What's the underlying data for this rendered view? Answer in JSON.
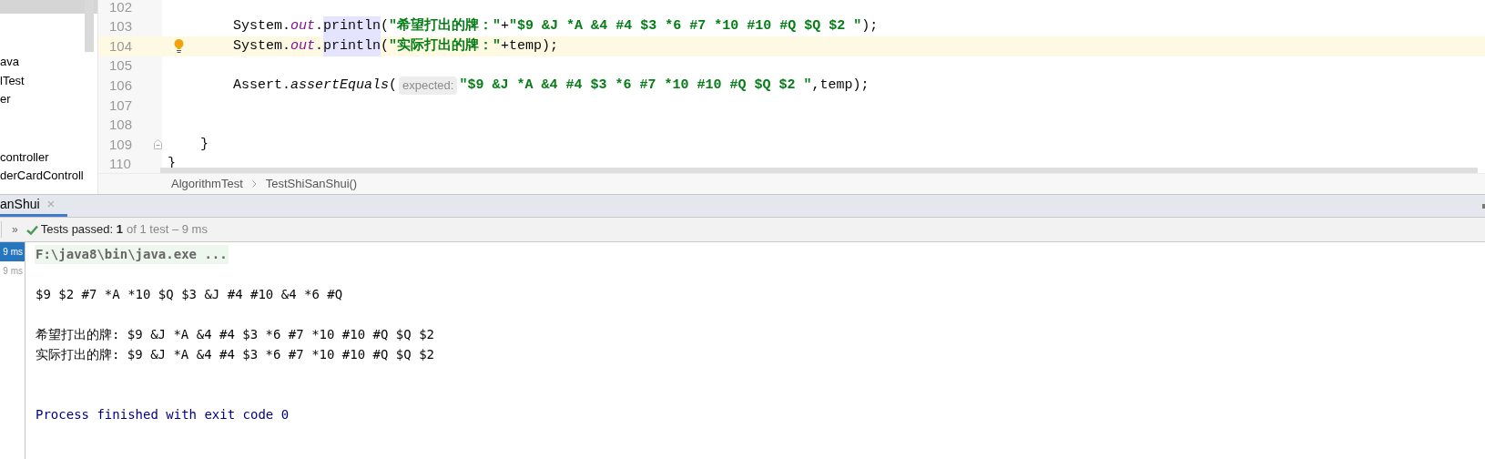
{
  "sidebar": {
    "groups": [
      [
        {
          "label": "ava"
        },
        {
          "label": "lTest"
        },
        {
          "label": "er"
        }
      ],
      [
        {
          "label": "controller"
        },
        {
          "label": "derCardControll"
        }
      ]
    ]
  },
  "editor": {
    "lines": [
      {
        "number": "102",
        "current": false,
        "bulb": false,
        "fold": false
      },
      {
        "number": "103",
        "kind": "statement",
        "current": false,
        "bulb": false,
        "fold": false,
        "segments": [
          {
            "kind": "plain",
            "text": "System."
          },
          {
            "kind": "field",
            "text": "out"
          },
          {
            "kind": "plain",
            "text": "."
          },
          {
            "kind": "highlight",
            "text": "println"
          },
          {
            "kind": "plain",
            "text": "("
          },
          {
            "kind": "string",
            "text": "\"希望打出的牌：\""
          },
          {
            "kind": "plain",
            "text": "+"
          },
          {
            "kind": "string",
            "text": "\"$9 &J *A &4 #4 $3 *6 #7 *10 #10 #Q $Q $2 \""
          },
          {
            "kind": "plain",
            "text": ");"
          }
        ]
      },
      {
        "number": "104",
        "kind": "statement",
        "current": true,
        "bulb": true,
        "fold": false,
        "segments": [
          {
            "kind": "plain",
            "text": "System."
          },
          {
            "kind": "field",
            "text": "out"
          },
          {
            "kind": "plain",
            "text": "."
          },
          {
            "kind": "highlight",
            "text": "println"
          },
          {
            "kind": "plain",
            "text": "("
          },
          {
            "kind": "string",
            "text": "\"实际打出的牌：\""
          },
          {
            "kind": "plain",
            "text": "+temp);"
          }
        ]
      },
      {
        "number": "105",
        "current": false,
        "bulb": false,
        "fold": false
      },
      {
        "number": "106",
        "kind": "statement",
        "current": false,
        "bulb": false,
        "fold": false,
        "segments": [
          {
            "kind": "plain",
            "text": "Assert."
          },
          {
            "kind": "call",
            "text": "assertEquals"
          },
          {
            "kind": "plain",
            "text": "("
          },
          {
            "kind": "hint",
            "text": "expected:"
          },
          {
            "kind": "string",
            "text": "\"$9 &J *A &4 #4 $3 *6 #7 *10 #10 #Q $Q $2 \""
          },
          {
            "kind": "plain",
            "text": ",temp);"
          }
        ]
      },
      {
        "number": "107",
        "current": false,
        "bulb": false,
        "fold": false
      },
      {
        "number": "108",
        "current": false,
        "bulb": false,
        "fold": false
      },
      {
        "number": "109",
        "kind": "method_end",
        "current": false,
        "bulb": false,
        "fold": true,
        "segments": [
          {
            "kind": "plain",
            "text": "}"
          }
        ]
      },
      {
        "number": "110",
        "kind": "class_end",
        "current": false,
        "bulb": false,
        "fold": false,
        "segments": [
          {
            "kind": "plain",
            "text": "}"
          }
        ]
      }
    ]
  },
  "breadcrumb": [
    "AlgorithmTest",
    "TestShiSanShui()"
  ],
  "run_tab": {
    "label": "anShui",
    "selected": true,
    "close": "×"
  },
  "toolbar": {
    "expand": "»",
    "status": "Tests passed:",
    "count": "1",
    "detail": "of 1 test – 9 ms"
  },
  "test_tree": [
    {
      "time": "9 ms",
      "selected": true
    },
    {
      "time": "9 ms",
      "selected": false
    }
  ],
  "console": {
    "lines": [
      {
        "kind": "command",
        "text": "F:\\java8\\bin\\java.exe ..."
      },
      {
        "kind": "blank"
      },
      {
        "kind": "output",
        "text": "$9 $2 #7 *A *10 $Q $3 &J #4 #10 &4 *6 #Q"
      },
      {
        "kind": "blank"
      },
      {
        "kind": "output",
        "text": "希望打出的牌: $9 &J *A &4 #4 $3 *6 #7 *10 #10 #Q $Q $2"
      },
      {
        "kind": "output",
        "text": "实际打出的牌: $9 &J *A &4 #4 $3 *6 #7 *10 #10 #Q $Q $2"
      },
      {
        "kind": "blank"
      },
      {
        "kind": "blank"
      },
      {
        "kind": "exit",
        "text": "Process finished with exit code 0"
      }
    ]
  }
}
